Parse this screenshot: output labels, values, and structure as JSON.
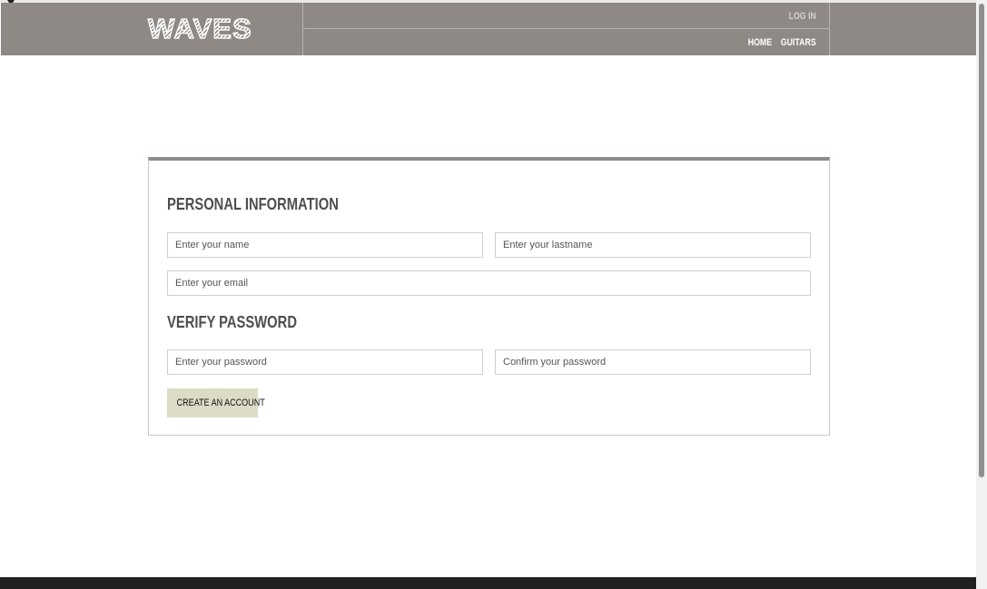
{
  "header": {
    "logo": "WAVES",
    "login": "LOG IN",
    "nav": {
      "home": "HOME",
      "guitars": "GUITARS"
    }
  },
  "form": {
    "personal_title": "PERSONAL INFORMATION",
    "name_placeholder": "Enter your name",
    "lastname_placeholder": "Enter your lastname",
    "email_placeholder": "Enter your email",
    "verify_title": "VERIFY PASSWORD",
    "password_placeholder": "Enter your password",
    "confirm_placeholder": "Confirm your password",
    "submit_label": "CREATE AN ACCOUNT"
  },
  "colors": {
    "header_bg": "#8e8985",
    "button_bg": "#dcdcc6",
    "footer_bg": "#232120"
  }
}
